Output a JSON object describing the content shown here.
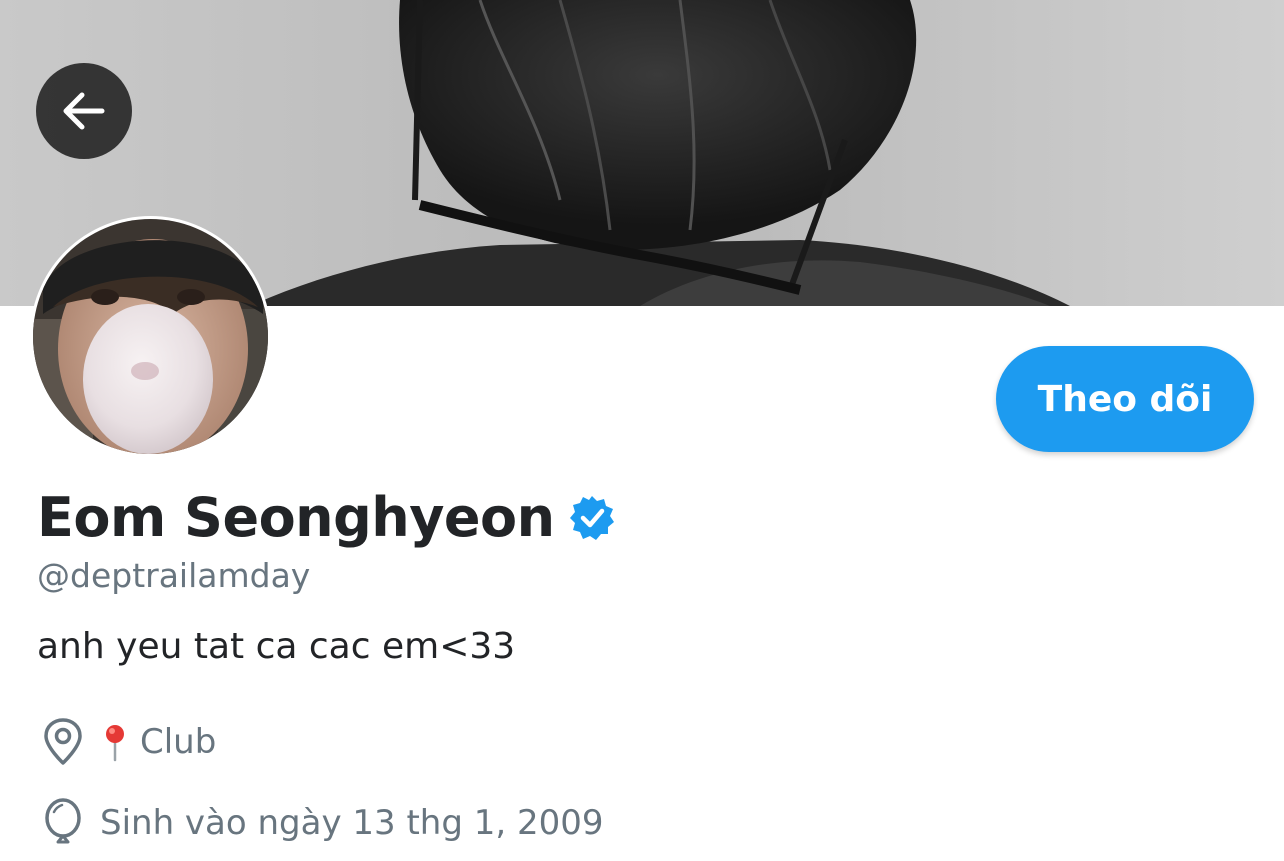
{
  "header": {
    "back_icon": "arrow-left-icon"
  },
  "profile": {
    "display_name": "Eom Seonghyeon",
    "verified_icon": "verified-badge-icon",
    "handle": "@deptrailamday",
    "bio": "anh yeu tat ca cac em<33",
    "follow_label": "Theo dõi",
    "location": {
      "icon": "location-pin-icon",
      "emoji": "pushpin-emoji",
      "text": "Club"
    },
    "birthday": {
      "icon": "balloon-icon",
      "text": "Sinh vào ngày 13 thg 1, 2009"
    }
  },
  "colors": {
    "accent": "#1d9bf0",
    "text_primary": "#222427",
    "text_secondary": "#68757f"
  }
}
